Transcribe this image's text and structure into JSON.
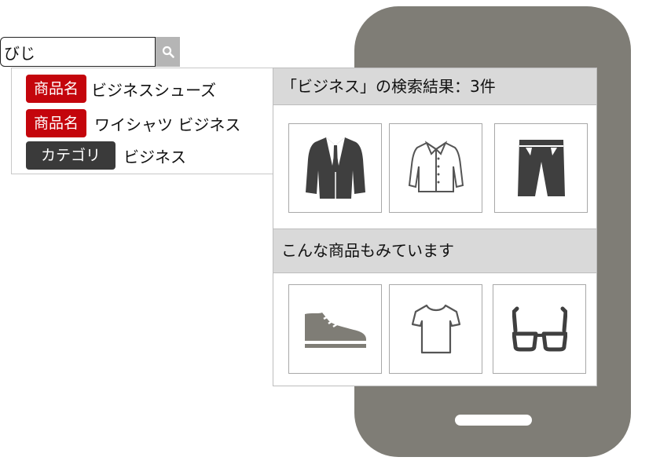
{
  "search": {
    "value": "びじ",
    "button_icon": "magnifier-icon"
  },
  "suggestions": [
    {
      "tag": "商品名",
      "text": "ビジネスシューズ",
      "tag_color": "#c4050c"
    },
    {
      "tag": "商品名",
      "text": "ワイシャツ ビジネス",
      "tag_color": "#c4050c"
    },
    {
      "tag": "カテゴリ",
      "text": "ビジネス",
      "tag_color": "#3a3a3a"
    }
  ],
  "results": {
    "header": "「ビジネス」の検索結果：3件",
    "items": [
      {
        "icon": "suit-jacket-icon"
      },
      {
        "icon": "dress-shirt-icon"
      },
      {
        "icon": "trousers-icon"
      }
    ]
  },
  "recommendations": {
    "header": "こんな商品もみています",
    "items": [
      {
        "icon": "sneaker-icon"
      },
      {
        "icon": "tshirt-icon"
      },
      {
        "icon": "glasses-icon"
      }
    ]
  },
  "colors": {
    "phone": "#7f7d76",
    "tag_product": "#c4050c",
    "tag_category": "#3a3a3a",
    "header_bg": "#d9d9d9"
  }
}
